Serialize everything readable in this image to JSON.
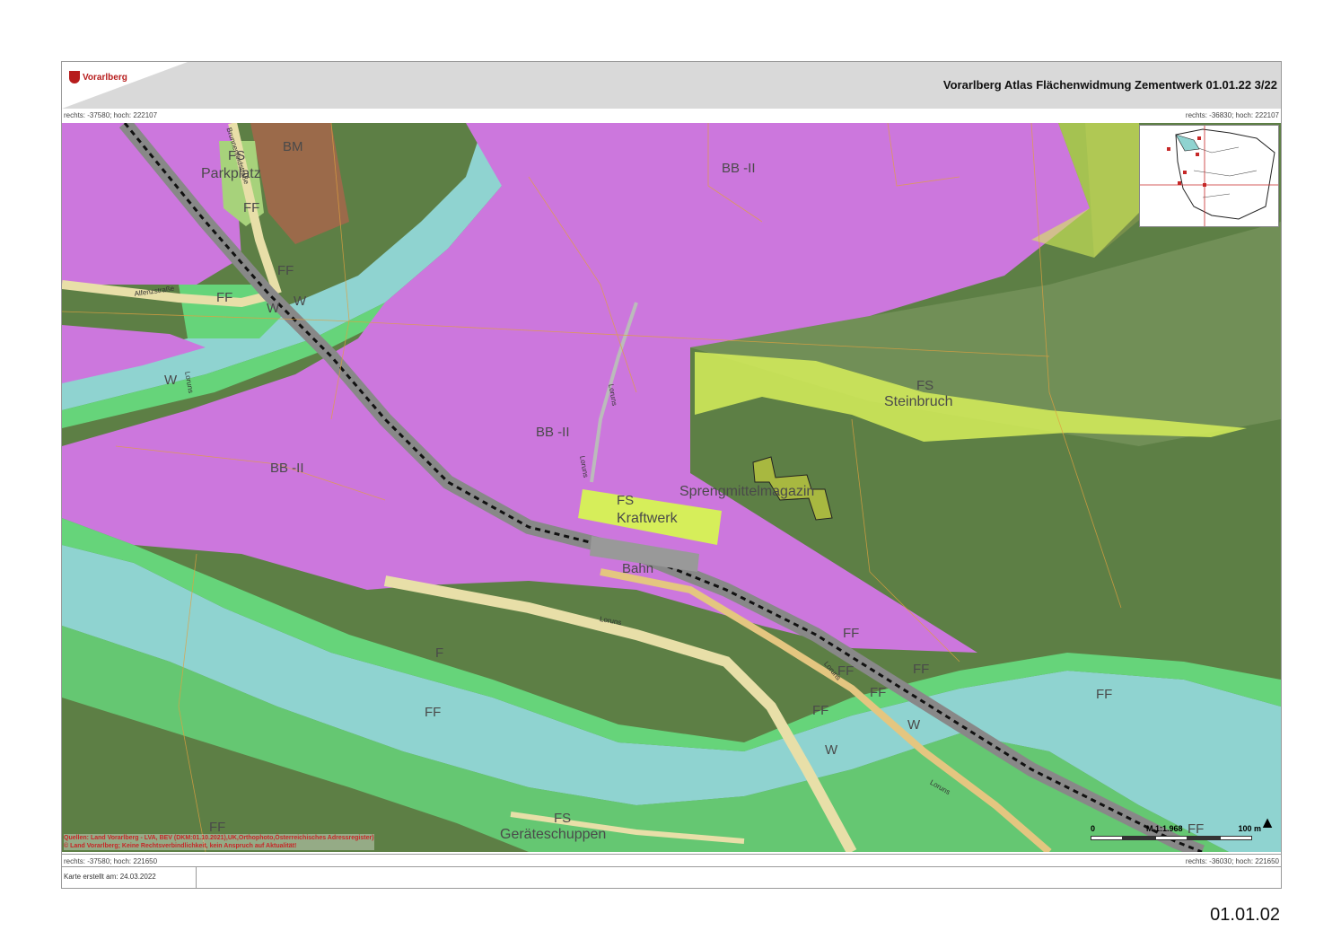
{
  "header": {
    "logo_text": "Vorarlberg",
    "title": "Vorarlberg Atlas Flächenwidmung Zementwerk  01.01.22  3/22"
  },
  "coords": {
    "top_left": "rechts: -37580; hoch: 222107",
    "top_right": "rechts: -36830; hoch: 222107",
    "bottom_left": "rechts: -37580; hoch: 221650",
    "bottom_right": "rechts: -36030; hoch: 221650"
  },
  "map": {
    "labels": {
      "bm": "BM",
      "parkplatz": "Parkplatz",
      "fs_top_left": "FS",
      "ff_top_left": "FF",
      "ff_rail": "FF",
      "ff_left": "FF",
      "w_left_1": "W",
      "w_left_2": "W",
      "w_left_3": "W",
      "bb_top": "BB -II",
      "bb_mid": "BB -II",
      "bb_left": "BB -II",
      "fs_steinbruch": "FS",
      "steinbruch": "Steinbruch",
      "fs_kraftwerk": "FS",
      "kraftwerk": "Kraftwerk",
      "sprengmittel": "Sprengmittelmagazin",
      "bahn": "Bahn",
      "f_forest": "F",
      "ff_river": "FF",
      "ff_b1": "FF",
      "ff_b2": "FF",
      "ff_b3": "FF",
      "ff_b4": "FF",
      "ff_b5": "FF",
      "ff_b6": "FF",
      "ff_b7": "FF",
      "ff_bottom_left": "FF",
      "ff_bottom_right": "FF",
      "w_river_1": "W",
      "w_river_2": "W",
      "fs_bottom": "FS",
      "geraeteschuppen": "Geräteschuppen",
      "street_1": "Brunnenfeldstraße",
      "street_2": "Alfenzstraße",
      "street_3": "Loruns",
      "street_4": "Loruns",
      "street_5": "Loruns",
      "street_6": "Loruns",
      "street_7": "Loruns",
      "street_8": "Loruns"
    },
    "sources_line1": "Quellen: Land Vorarlberg - LVA, BEV (DKM:01.10.2021),UK,Orthophoto,Österreichisches Adressregister)",
    "sources_line2": "© Land Vorarlberg; Keine Rechtsverbindlichkeit, kein Anspruch auf Aktualität!",
    "scale": {
      "start": "0",
      "ratio": "M 1:1.968",
      "end": "100 m"
    },
    "north_arrow": "▲"
  },
  "footer": {
    "created": "Karte erstellt am: 24.03.2022"
  },
  "page_number": "01.01.02",
  "colors": {
    "bauland_betrieb": "#cc77dd",
    "forest": "#5d7f45",
    "freiflaeche": "#66d47a",
    "water": "#8fd3d0",
    "sonderflaeche": "#d6ee5a",
    "mischgebiet": "#9b6a4a",
    "road": "#e8dfa8",
    "rail": "#888888"
  }
}
